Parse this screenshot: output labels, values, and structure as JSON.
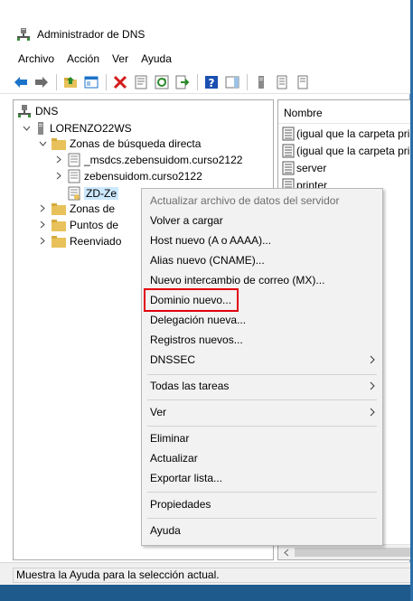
{
  "window": {
    "title": "Administrador de DNS"
  },
  "menubar": {
    "items": [
      "Archivo",
      "Acción",
      "Ver",
      "Ayuda"
    ]
  },
  "toolbar": {
    "buttons": [
      "back-arrow-icon",
      "forward-arrow-icon",
      "up-folder-icon",
      "console-tree-icon",
      "delete-icon",
      "properties-icon",
      "refresh-icon",
      "export-icon",
      "help-icon",
      "action-pane-icon",
      "server-icon",
      "zone-icon",
      "record-icon"
    ]
  },
  "tree": {
    "root": "DNS",
    "server": "LORENZO22WS",
    "forward_zones": "Zonas de búsqueda directa",
    "zone_1": "_msdcs.zebensuidom.curso2122",
    "zone_2": "zebensuidom.curso2122",
    "zone_3": "ZD-Ze",
    "reverse_zones": "Zonas de",
    "trust_points": "Puntos de",
    "forwarders": "Reenviado"
  },
  "list": {
    "header": "Nombre",
    "rows": [
      "(igual que la carpeta primaria)",
      "(igual que la carpeta primaria)",
      "server",
      "printer"
    ]
  },
  "context_menu": {
    "update_file": "Actualizar archivo de datos del servidor",
    "reload": "Volver a cargar",
    "new_host": "Host nuevo (A o AAAA)...",
    "new_alias": "Alias nuevo (CNAME)...",
    "new_mx": "Nuevo intercambio de correo (MX)...",
    "new_domain": "Dominio nuevo...",
    "new_delegation": "Delegación nueva...",
    "new_records": "Registros nuevos...",
    "dnssec": "DNSSEC",
    "all_tasks": "Todas las tareas",
    "view": "Ver",
    "delete": "Eliminar",
    "refresh": "Actualizar",
    "export_list": "Exportar lista...",
    "properties": "Propiedades",
    "help": "Ayuda"
  },
  "statusbar": {
    "text": "Muestra la Ayuda para la selección actual."
  },
  "colors": {
    "highlight_outline": "#e1000f",
    "selection": "#cce8ff",
    "folder": "#e8c15a",
    "toolbar_blue": "#1b72c9"
  }
}
